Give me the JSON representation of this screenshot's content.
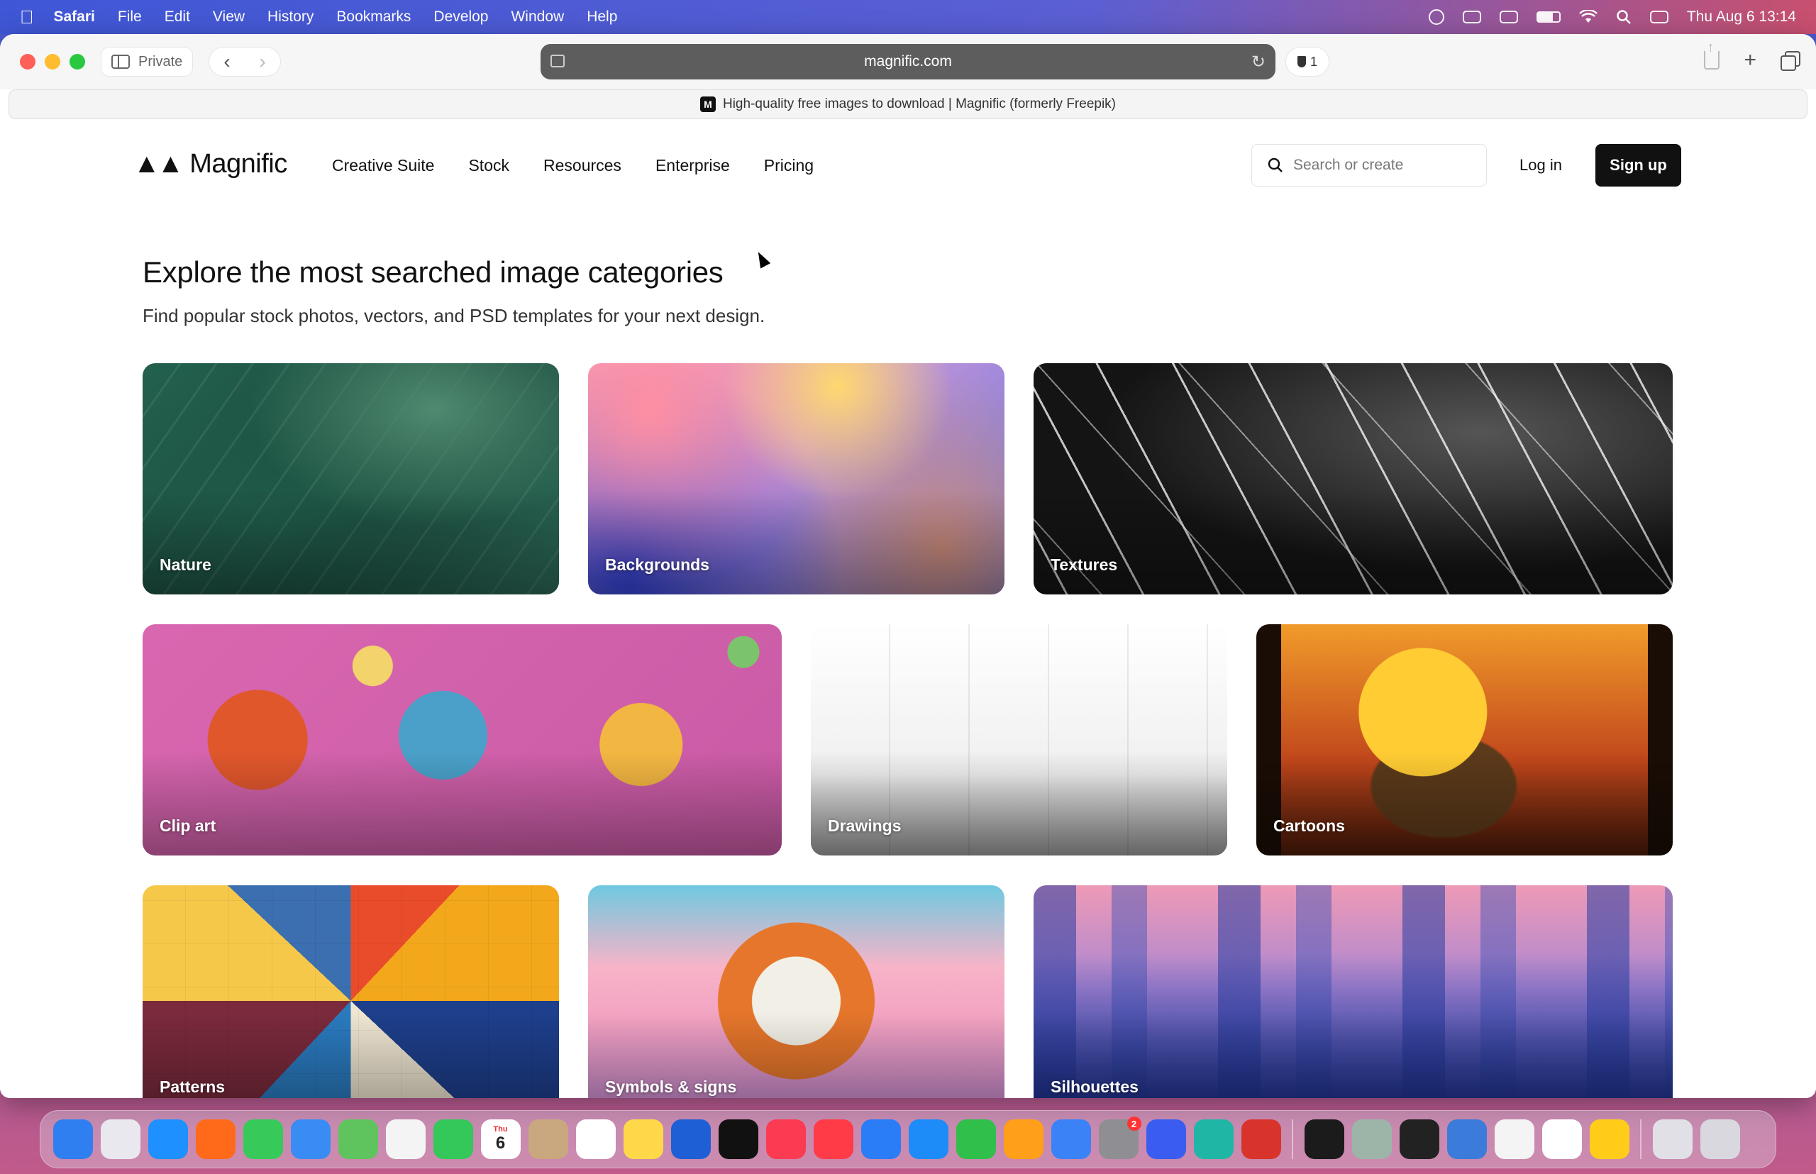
{
  "menubar": {
    "app_name": "Safari",
    "items": [
      "File",
      "Edit",
      "View",
      "History",
      "Bookmarks",
      "Develop",
      "Window",
      "Help"
    ],
    "clock": "Thu Aug 6  13:14"
  },
  "browser": {
    "private_label": "Private",
    "url": "magnific.com",
    "shield_count": "1",
    "tab_title": "High-quality free images to download | Magnific (formerly Freepik)"
  },
  "site": {
    "logo_text": "Magnific",
    "nav": [
      "Creative Suite",
      "Stock",
      "Resources",
      "Enterprise",
      "Pricing"
    ],
    "search_placeholder": "Search or create",
    "login_label": "Log in",
    "signup_label": "Sign up"
  },
  "content": {
    "heading": "Explore the most searched image categories",
    "subheading": "Find popular stock photos, vectors, and PSD templates for your next design.",
    "categories": [
      "Nature",
      "Backgrounds",
      "Textures",
      "Clip art",
      "Drawings",
      "Cartoons",
      "Patterns",
      "Symbols & signs",
      "Silhouettes"
    ]
  },
  "dock": {
    "apps": [
      {
        "name": "finder-icon",
        "color": "#2f7ff0"
      },
      {
        "name": "launchpad-icon",
        "color": "#e8e8ee"
      },
      {
        "name": "safari-icon",
        "color": "#1e90ff"
      },
      {
        "name": "firefox-icon",
        "color": "#ff6a1a"
      },
      {
        "name": "messages-icon",
        "color": "#37c95a"
      },
      {
        "name": "mail-icon",
        "color": "#3a8cf5"
      },
      {
        "name": "maps-icon",
        "color": "#5fc45d"
      },
      {
        "name": "photos-icon",
        "color": "#f4f4f4"
      },
      {
        "name": "facetime-icon",
        "color": "#34c759"
      },
      {
        "name": "calendar-icon",
        "color": "#ffffff"
      },
      {
        "name": "contacts-icon",
        "color": "#c9a77f"
      },
      {
        "name": "reminders-icon",
        "color": "#ffffff"
      },
      {
        "name": "notes-icon",
        "color": "#ffd84a"
      },
      {
        "name": "freeform-icon",
        "color": "#1f5fd6"
      },
      {
        "name": "tv-icon",
        "color": "#111111"
      },
      {
        "name": "music-icon",
        "color": "#fb3b52"
      },
      {
        "name": "news-icon",
        "color": "#ff3b47"
      },
      {
        "name": "keynote-icon",
        "color": "#2a7cf7"
      },
      {
        "name": "app-store-icon",
        "color": "#1d8cf8"
      },
      {
        "name": "numbers-icon",
        "color": "#2fbf4a"
      },
      {
        "name": "pages-icon",
        "color": "#ff9f1a"
      },
      {
        "name": "xcode-icon",
        "color": "#3b82f6"
      },
      {
        "name": "system-settings-icon",
        "color": "#8e8e93"
      },
      {
        "name": "simulator-icon",
        "color": "#3a5cf0"
      },
      {
        "name": "surfshark-icon",
        "color": "#1fb6a6"
      },
      {
        "name": "remote-icon",
        "color": "#d9342b"
      },
      {
        "name": "terminal-icon",
        "color": "#1b1b1b"
      },
      {
        "name": "preview-icon",
        "color": "#9cb5a8"
      },
      {
        "name": "activity-monitor-icon",
        "color": "#222222"
      },
      {
        "name": "disk-utility-icon",
        "color": "#3b7bd9"
      },
      {
        "name": "chrome-icon",
        "color": "#f4f4f4"
      },
      {
        "name": "spreadsheet-icon",
        "color": "#ffffff"
      },
      {
        "name": "tips-icon",
        "color": "#ffcc1a"
      },
      {
        "name": "downloads-icon",
        "color": "#e0e0e6"
      },
      {
        "name": "trash-icon",
        "color": "#d8d8de"
      }
    ],
    "calendar_day": "6",
    "calendar_month": "Thu",
    "settings_badge": "2"
  }
}
